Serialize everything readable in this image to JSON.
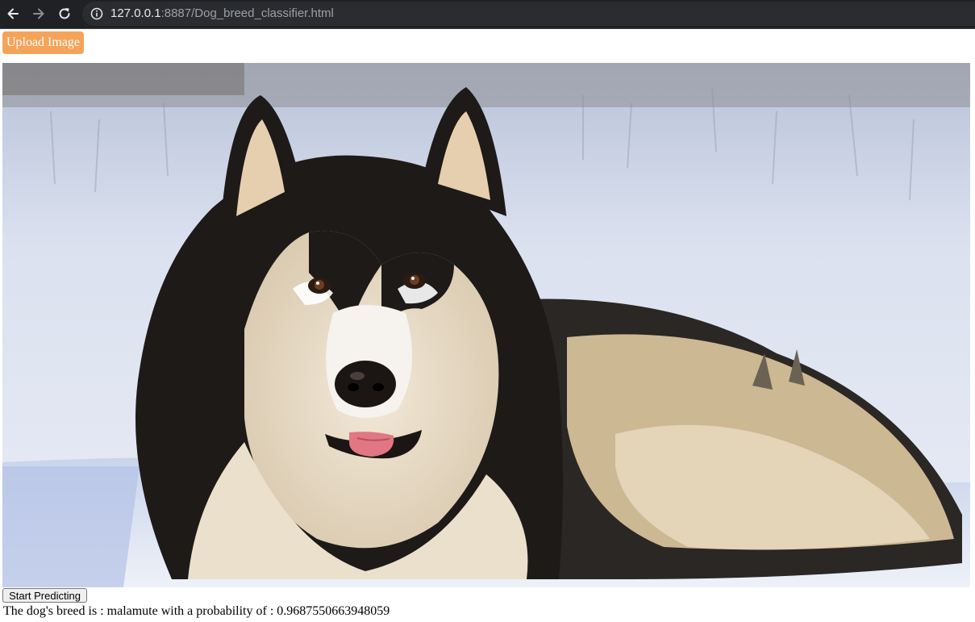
{
  "browser": {
    "url_host": "127.0.0.1",
    "url_rest": ":8887/Dog_breed_classifier.html"
  },
  "page": {
    "upload_label": "Upload Image",
    "predict_label": "Start Predicting",
    "result_prefix": "The dog's breed is : ",
    "result_breed": "malamute",
    "result_mid": " with a probability of : ",
    "result_probability": "0.9687550663948059"
  },
  "colors": {
    "upload_button": "#f6a35a",
    "browser_bar": "#202124"
  },
  "icons": [
    "back-arrow-icon",
    "forward-arrow-icon",
    "reload-icon",
    "site-info-icon"
  ]
}
